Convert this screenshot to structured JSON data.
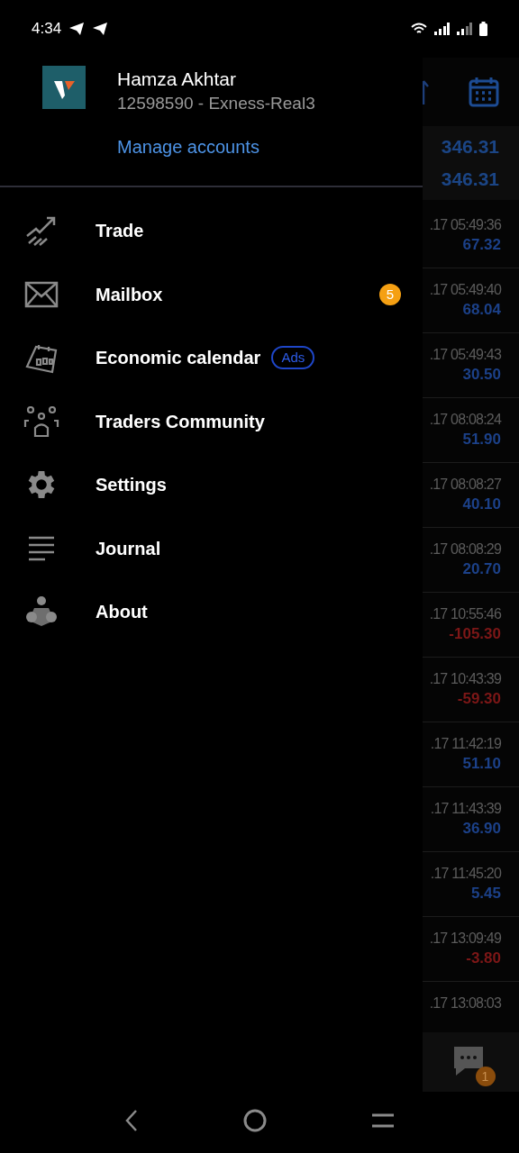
{
  "status_bar": {
    "time": "4:34"
  },
  "drawer": {
    "account": {
      "name": "Hamza Akhtar",
      "number": "12598590 - Exness-Real3",
      "manage_link": "Manage accounts"
    },
    "items": [
      {
        "kind": "trade",
        "label": "Trade"
      },
      {
        "kind": "mail",
        "label": "Mailbox",
        "badge": "5"
      },
      {
        "kind": "calendar",
        "label": "Economic calendar",
        "tag": "Ads"
      },
      {
        "kind": "community",
        "label": "Traders Community"
      },
      {
        "kind": "settings",
        "label": "Settings"
      },
      {
        "kind": "journal",
        "label": "Journal"
      },
      {
        "kind": "about",
        "label": "About"
      }
    ]
  },
  "background": {
    "totals": [
      "346.31",
      "346.31"
    ],
    "rows": [
      {
        "time": ".17 05:49:36",
        "value": "67.32",
        "kind": "profit"
      },
      {
        "time": ".17 05:49:40",
        "value": "68.04",
        "kind": "profit"
      },
      {
        "time": ".17 05:49:43",
        "value": "30.50",
        "kind": "profit"
      },
      {
        "time": ".17 08:08:24",
        "value": "51.90",
        "kind": "profit"
      },
      {
        "time": ".17 08:08:27",
        "value": "40.10",
        "kind": "profit"
      },
      {
        "time": ".17 08:08:29",
        "value": "20.70",
        "kind": "profit"
      },
      {
        "time": ".17 10:55:46",
        "value": "-105.30",
        "kind": "loss"
      },
      {
        "time": ".17 10:43:39",
        "value": "-59.30",
        "kind": "loss"
      },
      {
        "time": ".17 11:42:19",
        "value": "51.10",
        "kind": "profit"
      },
      {
        "time": ".17 11:43:39",
        "value": "36.90",
        "kind": "profit"
      },
      {
        "time": ".17 11:45:20",
        "value": "5.45",
        "kind": "profit"
      },
      {
        "time": ".17 13:09:49",
        "value": "-3.80",
        "kind": "loss"
      },
      {
        "time": ".17 13:08:03"
      }
    ],
    "chat_badge": "1"
  }
}
